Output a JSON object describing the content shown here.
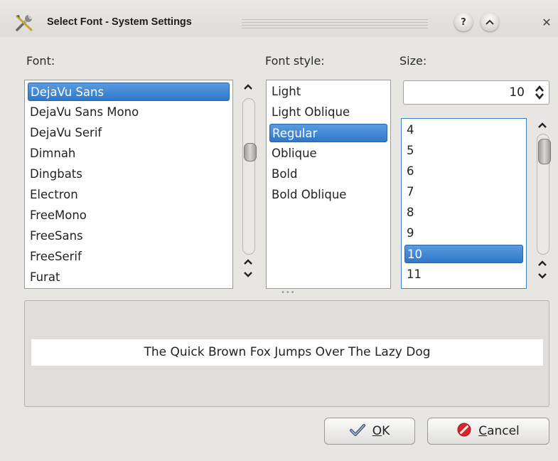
{
  "window": {
    "title": "Select Font - System Settings",
    "icons": {
      "app": "tools-icon",
      "help": "help-icon",
      "shade": "shade-icon",
      "close": "close-icon"
    },
    "help_glyph": "?",
    "shade_glyph": "^",
    "close_glyph": "✕"
  },
  "labels": {
    "font": "Font:",
    "font_style": "Font style:",
    "size": "Size:"
  },
  "font_list": {
    "items": [
      "DejaVu Sans",
      "DejaVu Sans Mono",
      "DejaVu Serif",
      "Dimnah",
      "Dingbats",
      "Electron",
      "FreeMono",
      "FreeSans",
      "FreeSerif",
      "Furat"
    ],
    "selected": "DejaVu Sans"
  },
  "style_list": {
    "items": [
      "Light",
      "Light Oblique",
      "Regular",
      "Oblique",
      "Bold",
      "Bold Oblique"
    ],
    "selected": "Regular"
  },
  "size": {
    "spin_value": "10",
    "items": [
      "4",
      "5",
      "6",
      "7",
      "8",
      "9",
      "10",
      "11"
    ],
    "selected": "10"
  },
  "preview": {
    "text": "The Quick Brown Fox Jumps Over The Lazy Dog"
  },
  "buttons": {
    "ok_label_accel": "O",
    "ok_label_rest": "K",
    "cancel_label_accel": "C",
    "cancel_label_rest": "ancel",
    "ok_icon": "checkmark-icon",
    "cancel_icon": "cancel-icon"
  },
  "colors": {
    "selection": "#3b80c8",
    "window_bg": "#e7e6e3",
    "cancel_icon": "#d9262b"
  }
}
